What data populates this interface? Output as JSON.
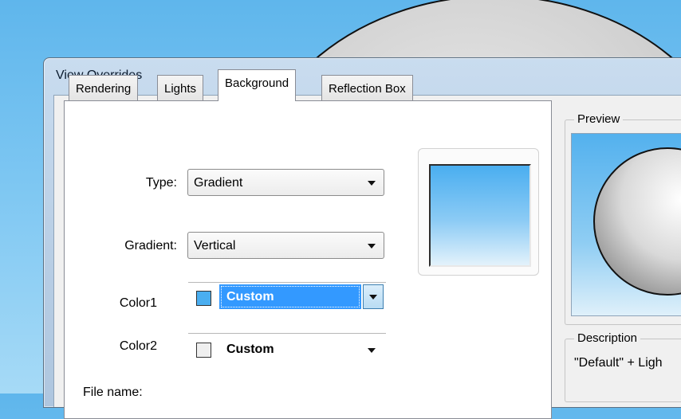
{
  "dialog": {
    "title": "View Overrides"
  },
  "tabs": [
    {
      "label": "Rendering",
      "active": false
    },
    {
      "label": "Lights",
      "active": false
    },
    {
      "label": "Background",
      "active": true
    },
    {
      "label": "Reflection Box",
      "active": false
    }
  ],
  "background_tab": {
    "type": {
      "label": "Type:",
      "value": "Gradient"
    },
    "gradient": {
      "label": "Gradient:",
      "value": "Vertical"
    },
    "color1": {
      "label": "Color1",
      "value": "Custom",
      "swatch": "#4aaef0"
    },
    "color2": {
      "label": "Color2",
      "value": "Custom",
      "swatch": "#efefef"
    },
    "file_name": {
      "label": "File name:"
    }
  },
  "preview": {
    "legend": "Preview"
  },
  "description": {
    "legend": "Description",
    "text": "\"Default\" + Ligh"
  },
  "colors": {
    "accent_selection": "#3399ff",
    "gradient_top": "#4aaef0",
    "gradient_bottom": "#e3f2fb"
  }
}
